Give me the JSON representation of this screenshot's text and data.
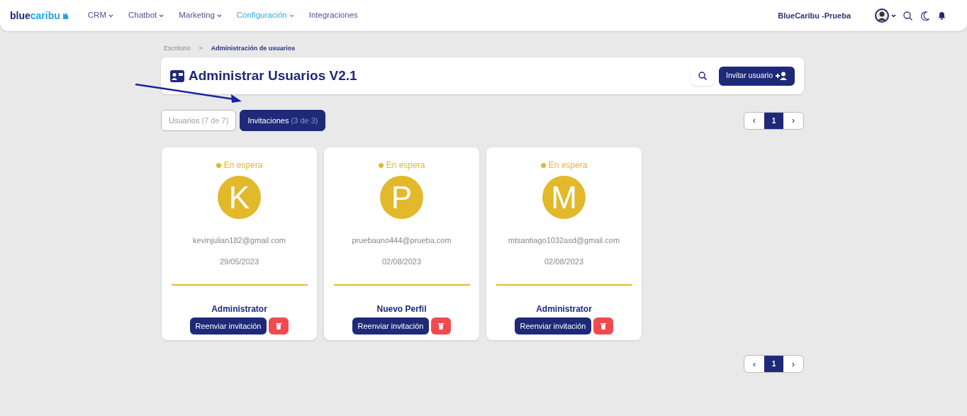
{
  "navbar": {
    "logo": {
      "part_1": "blue",
      "part_2": "caribu"
    },
    "items": [
      {
        "label": "CRM",
        "dropdown": true,
        "selected": false
      },
      {
        "label": "Chatbot",
        "dropdown": true,
        "selected": false
      },
      {
        "label": "Marketing",
        "dropdown": true,
        "selected": false
      },
      {
        "label": "Configuración",
        "dropdown": true,
        "selected": true
      },
      {
        "label": "Integraciones",
        "dropdown": false,
        "selected": false
      }
    ],
    "account": "BlueCaribu -Prueba"
  },
  "breadcrumb": [
    "Escritorio",
    "Administración de usuarios"
  ],
  "breadcrumb_separator": ">",
  "header": {
    "title": "Administrar Usuarios V2.1",
    "invite_button": "Invitar usuario"
  },
  "tabs": [
    {
      "label": "Usuarios",
      "count": "(7 de 7)",
      "selected": false
    },
    {
      "label": "Invitaciones",
      "count": "(3 de 3)",
      "selected": true
    }
  ],
  "pagination_top": {
    "prev": "‹",
    "next": "›",
    "pages": [
      {
        "label": "1",
        "selected": true
      }
    ]
  },
  "invitations": [
    {
      "status": "En espera",
      "color": "#e2b92a",
      "initial": "K",
      "email": "kevinjulian182@gmail.com",
      "date": "29/05/2023",
      "role": "Administrator",
      "resend": "Reenviar invitación"
    },
    {
      "status": "En espera",
      "color": "#e2b92a",
      "initial": "P",
      "email": "pruebauno444@prueba.com",
      "date": "02/08/2023",
      "role": "Nuevo Perfil",
      "resend": "Reenviar invitación"
    },
    {
      "status": "En espera",
      "color": "#e2b92a",
      "initial": "M",
      "email": "mtsantiago1032asd@gmail.com",
      "date": "02/08/2023",
      "role": "Administrator",
      "resend": "Reenviar invitación"
    }
  ],
  "pagination_bottom": {
    "prev": "‹",
    "next": "›",
    "pages": [
      {
        "label": "1",
        "selected": true
      }
    ]
  }
}
